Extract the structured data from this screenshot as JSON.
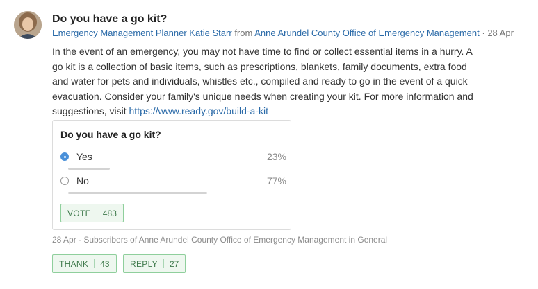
{
  "post": {
    "title": "Do you have a go kit?",
    "author": "Emergency Management Planner Katie Starr",
    "from_word": "from",
    "organization": "Anne Arundel County Office of Emergency Management",
    "date_sep": "·",
    "date": "28 Apr",
    "body": "In the event of an emergency, you may not have time to find or collect essential items in a hurry. A go kit is a collection of basic items, such as prescriptions, blankets, family documents, extra food and water for pets and individuals, whistles etc., compiled and ready to go in the event of a quick evacuation. Consider your family's unique needs when creating your kit. For more information and suggestions, visit ",
    "link": "https://www.ready.gov/build-a-kit"
  },
  "poll": {
    "question": "Do you have a go kit?",
    "options": [
      {
        "label": "Yes",
        "percent_label": "23%",
        "percent": 23,
        "selected": true
      },
      {
        "label": "No",
        "percent_label": "77%",
        "percent": 77,
        "selected": false
      }
    ],
    "vote_label": "VOTE",
    "vote_count": "483"
  },
  "footer": {
    "meta": "28 Apr · Subscribers of Anne Arundel County Office of Emergency Management in General"
  },
  "actions": {
    "thank_label": "THANK",
    "thank_count": "43",
    "reply_label": "REPLY",
    "reply_count": "27"
  },
  "colors": {
    "link": "#2a6aa8",
    "radio_selected": "#4a90d9",
    "button_border": "#8fcf9c",
    "button_bg": "#eef7ef",
    "button_text": "#3f7a4c"
  }
}
